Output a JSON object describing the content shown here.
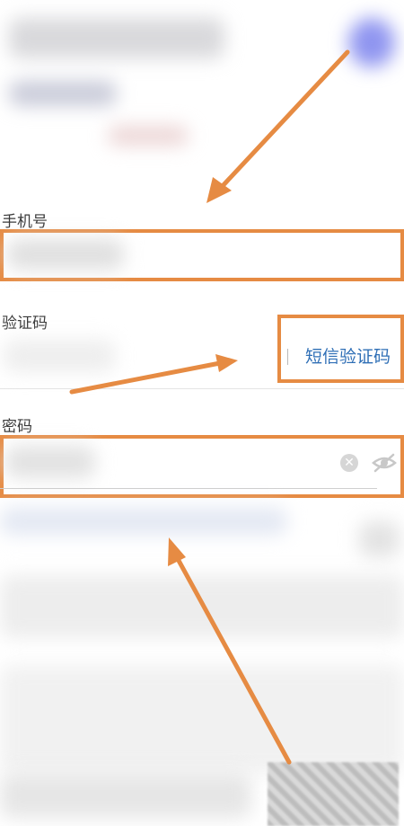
{
  "form": {
    "phone": {
      "label": "手机号",
      "value": ""
    },
    "code": {
      "label": "验证码",
      "value": "",
      "sms_button": "短信验证码"
    },
    "password": {
      "label": "密码",
      "value": ""
    }
  },
  "icons": {
    "clear": "clear-circle-icon",
    "visibility": "eye-hidden-icon"
  },
  "colors": {
    "annotation": "#e68b43",
    "link": "#2f6fb6",
    "avatar": "#8f95f0"
  }
}
